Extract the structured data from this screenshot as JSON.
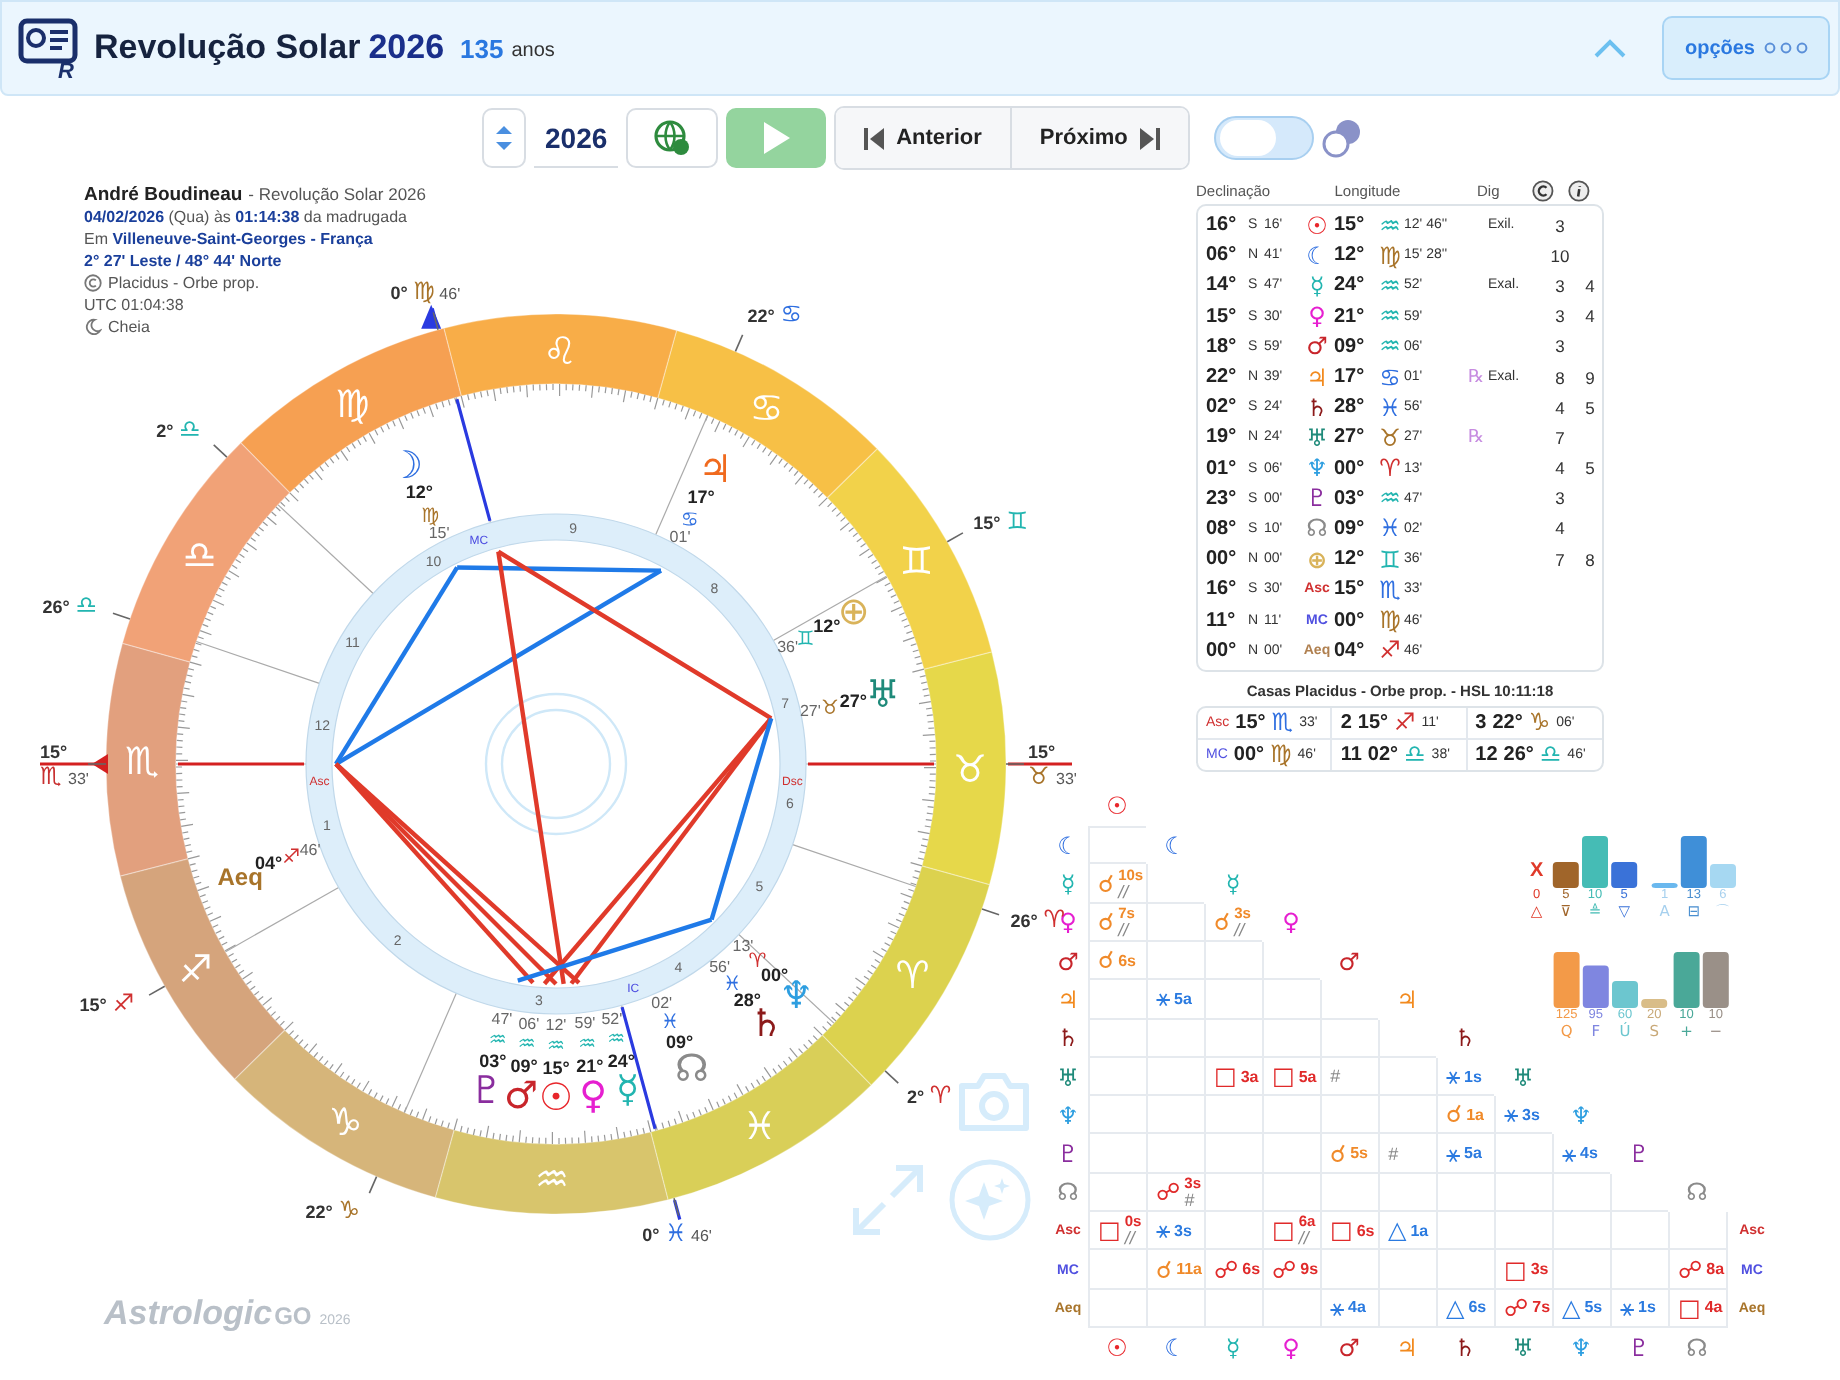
{
  "header": {
    "logo_letter": "R",
    "title": "Revolução Solar",
    "year": "2026",
    "age": "135",
    "age_unit": "anos",
    "options_button": "opções"
  },
  "toolbar": {
    "year": "2026",
    "previous": "Anterior",
    "next": "Próximo",
    "toggle": {
      "on": false
    }
  },
  "info": {
    "name": "André Boudineau",
    "subtitle": "- Revolução Solar 2026",
    "date_line": "**04/02/2026** (Qua) às **01:14:38** da madrugada",
    "place_line": "Em **Villeneuve-Saint-Georges - França**",
    "coordinates": "2° 27' Leste / 48° 44' Norte",
    "house_system": "Placidus - Orbe prop.",
    "utc": "UTC 01:04:38",
    "moon_phase": "Cheia"
  },
  "wheel": {
    "signs": [
      "♈",
      "♉",
      "♊",
      "♋",
      "♌",
      "♍",
      "♎",
      "♏",
      "♐",
      "♑",
      "♒",
      "♓"
    ],
    "houses": [
      "1",
      "2",
      "3",
      "4",
      "5",
      "6",
      "7",
      "8",
      "9",
      "10",
      "11",
      "12"
    ],
    "angle_labels": [
      "Asc",
      "MC",
      "Dsc",
      "IC"
    ],
    "cusps": [
      {
        "deg": "15°",
        "sign": {
          "symbol": "♏",
          "color": "#c83030"
        },
        "min": "33'"
      },
      {
        "deg": "15°",
        "sign": {
          "symbol": "♐",
          "color": "#d03030"
        }
      },
      {
        "deg": "22°",
        "sign": {
          "symbol": "♑",
          "color": "#a8742a"
        }
      },
      {
        "deg": "0°",
        "sign": {
          "symbol": "♓",
          "color": "#2f6fe0"
        },
        "min": "46'"
      },
      {
        "deg": "2°",
        "sign": {
          "symbol": "♈",
          "color": "#d03030"
        }
      },
      {
        "deg": "26°",
        "sign": {
          "symbol": "♈",
          "color": "#d03030"
        }
      },
      {
        "deg": "15°",
        "sign": {
          "symbol": "♉",
          "color": "#a8742a"
        },
        "min": "33'"
      },
      {
        "deg": "15°",
        "sign": {
          "symbol": "♊",
          "color": "#22b5b0"
        }
      },
      {
        "deg": "22°",
        "sign": {
          "symbol": "♋",
          "color": "#2f6fe0"
        }
      },
      {
        "deg": "0°",
        "sign": {
          "symbol": "♍",
          "color": "#a8742a"
        },
        "min": "46'"
      },
      {
        "deg": "2°",
        "sign": {
          "symbol": "♎",
          "color": "#22b5b0"
        }
      },
      {
        "deg": "26°",
        "sign": {
          "symbol": "♎",
          "color": "#22b5b0"
        }
      }
    ],
    "planets": [
      {
        "symbol": "☽",
        "color": "#2f6fe0",
        "deg": "12°",
        "sign": {
          "symbol": "♍",
          "color": "#a8742a"
        },
        "min": "15'"
      },
      {
        "symbol": "♃",
        "color": "#f06a1e",
        "deg": "17°",
        "sign": {
          "symbol": "♋",
          "color": "#2f6fe0"
        },
        "min": "01'"
      },
      {
        "symbol": "⊕",
        "color": "#d9b35a",
        "deg": "12°",
        "sign": {
          "symbol": "♊",
          "color": "#22b5b0"
        },
        "min": "36'"
      },
      {
        "symbol": "♅",
        "color": "#1f8a7a",
        "deg": "27°",
        "sign": {
          "symbol": "♉",
          "color": "#a8742a"
        },
        "min": "27'"
      },
      {
        "symbol": "Aeq",
        "color": "#a8742a",
        "deg": "04°",
        "sign": {
          "symbol": "♐",
          "color": "#d03030"
        },
        "min": "46'"
      },
      {
        "symbol": "♆",
        "color": "#2d9ee0",
        "deg": "00°",
        "sign": {
          "symbol": "♈",
          "color": "#d03030"
        },
        "min": "13'"
      },
      {
        "symbol": "♄",
        "color": "#8c1a1a",
        "deg": "28°",
        "sign": {
          "symbol": "♓",
          "color": "#2f6fe0"
        },
        "min": "56'"
      },
      {
        "symbol": "☊",
        "color": "#8a8a8a",
        "deg": "09°",
        "sign": {
          "symbol": "♓",
          "color": "#2f6fe0"
        },
        "min": "02'"
      },
      {
        "symbol": "♇",
        "color": "#8a2d9e",
        "deg": "03°",
        "sign": {
          "symbol": "♒",
          "color": "#22b5b0"
        },
        "min": "47'"
      },
      {
        "symbol": "♂",
        "color": "#c8252b",
        "deg": "09°",
        "sign": {
          "symbol": "♒",
          "color": "#22b5b0"
        },
        "min": "06'"
      },
      {
        "symbol": "☉",
        "color": "#e8262b",
        "deg": "15°",
        "sign": {
          "symbol": "♒",
          "color": "#22b5b0"
        },
        "min": "12'"
      },
      {
        "symbol": "♀",
        "color": "#e61fd0",
        "deg": "21°",
        "sign": {
          "symbol": "♒",
          "color": "#22b5b0"
        },
        "min": "59'"
      },
      {
        "symbol": "☿",
        "color": "#22b5b0",
        "deg": "24°",
        "sign": {
          "symbol": "♒",
          "color": "#22b5b0"
        },
        "min": "52'"
      }
    ]
  },
  "positions": {
    "columns": [
      "Declinação",
      "Longitude",
      "Dig"
    ],
    "rows": [
      {
        "decl": "16°",
        "dir": "S",
        "decl_min": "16'",
        "symbol": "☉",
        "color": "#e8262b",
        "lon": "15°",
        "sign": {
          "symbol": "♒",
          "color": "#22b5b0"
        },
        "lon_min": "12' 46''",
        "dignity": "Exil.",
        "c": "3"
      },
      {
        "decl": "06°",
        "dir": "N",
        "decl_min": "41'",
        "symbol": "☾",
        "color": "#2f6fe0",
        "lon": "12°",
        "sign": {
          "symbol": "♍",
          "color": "#a8742a"
        },
        "lon_min": "15' 28''",
        "c": "10"
      },
      {
        "decl": "14°",
        "dir": "S",
        "decl_min": "47'",
        "symbol": "☿",
        "color": "#22b5b0",
        "lon": "24°",
        "sign": {
          "symbol": "♒",
          "color": "#22b5b0"
        },
        "lon_min": "52'",
        "dignity": "Exal.",
        "c": "3",
        "i": "4"
      },
      {
        "decl": "15°",
        "dir": "S",
        "decl_min": "30'",
        "symbol": "♀",
        "color": "#e61fd0",
        "lon": "21°",
        "sign": {
          "symbol": "♒",
          "color": "#22b5b0"
        },
        "lon_min": "59'",
        "c": "3",
        "i": "4"
      },
      {
        "decl": "18°",
        "dir": "S",
        "decl_min": "59'",
        "symbol": "♂",
        "color": "#c8252b",
        "lon": "09°",
        "sign": {
          "symbol": "♒",
          "color": "#22b5b0"
        },
        "lon_min": "06'",
        "c": "3"
      },
      {
        "decl": "22°",
        "dir": "N",
        "decl_min": "39'",
        "symbol": "♃",
        "color": "#f28a1e",
        "lon": "17°",
        "sign": {
          "symbol": "♋",
          "color": "#2f6fe0"
        },
        "lon_min": "01'",
        "retro": "℞",
        "dignity": "Exal.",
        "c": "8",
        "i": "9"
      },
      {
        "decl": "02°",
        "dir": "S",
        "decl_min": "24'",
        "symbol": "♄",
        "color": "#8c1a1a",
        "lon": "28°",
        "sign": {
          "symbol": "♓",
          "color": "#2f6fe0"
        },
        "lon_min": "56'",
        "c": "4",
        "i": "5"
      },
      {
        "decl": "19°",
        "dir": "N",
        "decl_min": "24'",
        "symbol": "♅",
        "color": "#1f8a7a",
        "lon": "27°",
        "sign": {
          "symbol": "♉",
          "color": "#a8742a"
        },
        "lon_min": "27'",
        "retro": "℞",
        "c": "7"
      },
      {
        "decl": "01°",
        "dir": "S",
        "decl_min": "06'",
        "symbol": "♆",
        "color": "#2d9ee0",
        "lon": "00°",
        "sign": {
          "symbol": "♈",
          "color": "#d03030"
        },
        "lon_min": "13'",
        "c": "4",
        "i": "5"
      },
      {
        "decl": "23°",
        "dir": "S",
        "decl_min": "00'",
        "symbol": "♇",
        "color": "#8a2d9e",
        "lon": "03°",
        "sign": {
          "symbol": "♒",
          "color": "#22b5b0"
        },
        "lon_min": "47'",
        "c": "3"
      },
      {
        "decl": "08°",
        "dir": "S",
        "decl_min": "10'",
        "symbol": "☊",
        "color": "#8a8a8a",
        "lon": "09°",
        "sign": {
          "symbol": "♓",
          "color": "#2f6fe0"
        },
        "lon_min": "02'",
        "c": "4"
      },
      {
        "decl": "00°",
        "dir": "N",
        "decl_min": "00'",
        "symbol": "⊕",
        "color": "#d9b35a",
        "lon": "12°",
        "sign": {
          "symbol": "♊",
          "color": "#22b5b0"
        },
        "lon_min": "36'",
        "c": "7",
        "i": "8"
      },
      {
        "decl": "16°",
        "dir": "S",
        "decl_min": "30'",
        "symbol": "Asc",
        "color": "#d03030",
        "lon": "15°",
        "sign": {
          "symbol": "♏",
          "color": "#2f6fe0"
        },
        "lon_min": "33'"
      },
      {
        "decl": "11°",
        "dir": "N",
        "decl_min": "11'",
        "symbol": "MC",
        "color": "#5050e0",
        "lon": "00°",
        "sign": {
          "symbol": "♍",
          "color": "#a8742a"
        },
        "lon_min": "46'"
      },
      {
        "decl": "00°",
        "dir": "N",
        "decl_min": "00'",
        "symbol": "Aeq",
        "color": "#b08050",
        "lon": "04°",
        "sign": {
          "symbol": "♐",
          "color": "#d03030"
        },
        "lon_min": "46'"
      }
    ]
  },
  "houses": {
    "title": "Casas Placidus - Orbe prop. - HSL 10:11:18",
    "cells": [
      {
        "label": "Asc",
        "color": "#d03030",
        "deg": "15°",
        "sign": {
          "symbol": "♏",
          "color": "#2f6fe0"
        },
        "min": "33'"
      },
      {
        "label": "2",
        "deg": "15°",
        "sign": {
          "symbol": "♐",
          "color": "#d03030"
        },
        "min": "11'"
      },
      {
        "label": "3",
        "deg": "22°",
        "sign": {
          "symbol": "♑",
          "color": "#a8742a"
        },
        "min": "06'"
      },
      {
        "label": "MC",
        "color": "#5050e0",
        "deg": "00°",
        "sign": {
          "symbol": "♍",
          "color": "#a8742a"
        },
        "min": "46'"
      },
      {
        "label": "11",
        "deg": "02°",
        "sign": {
          "symbol": "♎",
          "color": "#22b5b0"
        },
        "min": "38'"
      },
      {
        "label": "12",
        "deg": "26°",
        "sign": {
          "symbol": "♎",
          "color": "#22b5b0"
        },
        "min": "46'"
      }
    ]
  },
  "aspect_grid": {
    "rows": [
      {
        "diagonal": {
          "symbol": "☉",
          "color": "#e8262b"
        }
      },
      {
        "label": {
          "symbol": "☾",
          "color": "#2f6fe0"
        },
        "cells": [
          null
        ],
        "diagonal": {
          "symbol": "☾",
          "color": "#2f6fe0"
        }
      },
      {
        "label": {
          "symbol": "☿",
          "color": "#22b5b0"
        },
        "cells": [
          {
            "kind": "conjunction",
            "symbol": "☌",
            "orb": "10s",
            "parallel": "//"
          },
          null
        ],
        "diagonal": {
          "symbol": "☿",
          "color": "#22b5b0"
        }
      },
      {
        "label": {
          "symbol": "♀",
          "color": "#e61fd0"
        },
        "cells": [
          {
            "kind": "conjunction",
            "symbol": "☌",
            "orb": "7s",
            "parallel": "//"
          },
          null,
          {
            "kind": "conjunction",
            "symbol": "☌",
            "orb": "3s",
            "parallel": "//"
          }
        ],
        "diagonal": {
          "symbol": "♀",
          "color": "#e61fd0"
        }
      },
      {
        "label": {
          "symbol": "♂",
          "color": "#c8252b"
        },
        "cells": [
          {
            "kind": "conjunction",
            "symbol": "☌",
            "orb": "6s"
          },
          null,
          null,
          null
        ],
        "diagonal": {
          "symbol": "♂",
          "color": "#c8252b"
        }
      },
      {
        "label": {
          "symbol": "♃",
          "color": "#f28a1e"
        },
        "cells": [
          null,
          {
            "kind": "sextile",
            "symbol": "⚹",
            "orb": "5a"
          },
          null,
          null,
          null
        ],
        "diagonal": {
          "symbol": "♃",
          "color": "#f28a1e"
        }
      },
      {
        "label": {
          "symbol": "♄",
          "color": "#8c1a1a"
        },
        "cells": [
          null,
          null,
          null,
          null,
          null,
          null
        ],
        "diagonal": {
          "symbol": "♄",
          "color": "#8c1a1a"
        }
      },
      {
        "label": {
          "symbol": "♅",
          "color": "#1f8a7a"
        },
        "cells": [
          null,
          null,
          {
            "kind": "square",
            "symbol": "□",
            "orb": "3a"
          },
          {
            "kind": "square",
            "symbol": "□",
            "orb": "5a"
          },
          {
            "parallel": "#"
          },
          null,
          {
            "kind": "sextile",
            "symbol": "⚹",
            "orb": "1s"
          }
        ],
        "diagonal": {
          "symbol": "♅",
          "color": "#1f8a7a"
        }
      },
      {
        "label": {
          "symbol": "♆",
          "color": "#2d9ee0"
        },
        "cells": [
          null,
          null,
          null,
          null,
          null,
          null,
          {
            "kind": "conjunction",
            "symbol": "☌",
            "orb": "1a"
          },
          {
            "kind": "sextile",
            "symbol": "⚹",
            "orb": "3s"
          }
        ],
        "diagonal": {
          "symbol": "♆",
          "color": "#2d9ee0"
        }
      },
      {
        "label": {
          "symbol": "♇",
          "color": "#8a2d9e"
        },
        "cells": [
          null,
          null,
          null,
          null,
          {
            "kind": "conjunction",
            "symbol": "☌",
            "orb": "5s"
          },
          {
            "parallel": "#"
          },
          {
            "kind": "sextile",
            "symbol": "⚹",
            "orb": "5a"
          },
          null,
          {
            "kind": "sextile",
            "symbol": "⚹",
            "orb": "4s"
          }
        ],
        "diagonal": {
          "symbol": "♇",
          "color": "#8a2d9e"
        }
      },
      {
        "label": {
          "symbol": "☊",
          "color": "#8a8a8a"
        },
        "cells": [
          null,
          {
            "kind": "opposition",
            "symbol": "☍",
            "orb": "3s",
            "parallel": "#"
          },
          null,
          null,
          null,
          null,
          null,
          null,
          null,
          null
        ],
        "diagonal": {
          "symbol": "☊",
          "color": "#8a8a8a"
        }
      },
      {
        "label": {
          "symbol": "Asc",
          "color": "#d03030"
        },
        "cells": [
          {
            "kind": "square",
            "symbol": "□",
            "orb": "0s",
            "parallel": "//"
          },
          {
            "kind": "sextile",
            "symbol": "⚹",
            "orb": "3s"
          },
          null,
          {
            "kind": "square",
            "symbol": "□",
            "orb": "6a",
            "parallel": "//"
          },
          {
            "kind": "square",
            "symbol": "□",
            "orb": "6s"
          },
          {
            "kind": "trine",
            "symbol": "△",
            "orb": "1a"
          },
          null,
          null,
          null,
          null,
          null
        ],
        "end_label": {
          "symbol": "Asc",
          "color": "#d03030"
        }
      },
      {
        "label": {
          "symbol": "MC",
          "color": "#5050e0"
        },
        "cells": [
          null,
          {
            "kind": "conjunction",
            "symbol": "☌",
            "orb": "11a"
          },
          {
            "kind": "opposition",
            "symbol": "☍",
            "orb": "6s"
          },
          {
            "kind": "opposition",
            "symbol": "☍",
            "orb": "9s"
          },
          null,
          null,
          null,
          {
            "kind": "square",
            "symbol": "□",
            "orb": "3s"
          },
          null,
          null,
          {
            "kind": "opposition",
            "symbol": "☍",
            "orb": "8a"
          }
        ],
        "end_label": {
          "symbol": "MC",
          "color": "#5050e0"
        }
      },
      {
        "label": {
          "symbol": "Aeq",
          "color": "#a8742a"
        },
        "cells": [
          null,
          null,
          null,
          null,
          {
            "kind": "sextile",
            "symbol": "⚹",
            "orb": "4a"
          },
          null,
          {
            "kind": "trine",
            "symbol": "△",
            "orb": "6s"
          },
          {
            "kind": "opposition",
            "symbol": "☍",
            "orb": "7s"
          },
          {
            "kind": "trine",
            "symbol": "△",
            "orb": "5s"
          },
          {
            "kind": "sextile",
            "symbol": "⚹",
            "orb": "1s"
          },
          {
            "kind": "square",
            "symbol": "□",
            "orb": "4a"
          }
        ],
        "end_label": {
          "symbol": "Aeq",
          "color": "#a8742a"
        }
      }
    ],
    "bottom_labels": [
      {
        "symbol": "☉",
        "color": "#e8262b"
      },
      {
        "symbol": "☾",
        "color": "#2f6fe0"
      },
      {
        "symbol": "☿",
        "color": "#22b5b0"
      },
      {
        "symbol": "♀",
        "color": "#e61fd0"
      },
      {
        "symbol": "♂",
        "color": "#c8252b"
      },
      {
        "symbol": "♃",
        "color": "#f28a1e"
      },
      {
        "symbol": "♄",
        "color": "#8c1a1a"
      },
      {
        "symbol": "♅",
        "color": "#1f8a7a"
      },
      {
        "symbol": "♆",
        "color": "#2d9ee0"
      },
      {
        "symbol": "♇",
        "color": "#8a2d9e"
      },
      {
        "symbol": "☊",
        "color": "#8a8a8a"
      }
    ]
  },
  "charts": [
    {
      "chart_data": {
        "type": "bar",
        "categories": [
          "△",
          "⊽",
          "≜",
          "▽"
        ],
        "values": [
          0,
          5,
          10,
          5
        ],
        "data_labels": true,
        "annotations": [
          "X"
        ]
      }
    },
    {
      "chart_data": {
        "type": "bar",
        "categories": [
          "A",
          "⊟",
          "⌒"
        ],
        "values": [
          1,
          13,
          6
        ],
        "data_labels": true
      }
    },
    {
      "chart_data": {
        "type": "bar",
        "categories": [
          "Q",
          "F",
          "Ú",
          "S"
        ],
        "values": [
          125,
          95,
          60,
          20
        ],
        "data_labels": true
      }
    },
    {
      "chart_data": {
        "type": "bar",
        "categories": [
          "+",
          "−"
        ],
        "values": [
          10,
          10
        ],
        "data_labels": true
      }
    }
  ],
  "brand": {
    "name": "Astrologic",
    "suffix": "GO",
    "year": "2026"
  }
}
